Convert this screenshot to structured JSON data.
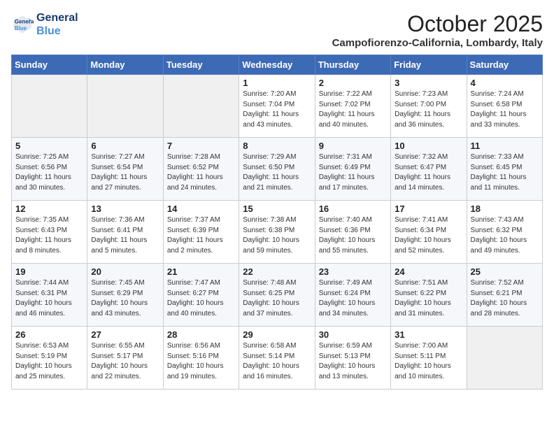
{
  "header": {
    "logo_line1": "General",
    "logo_line2": "Blue",
    "month": "October 2025",
    "location": "Campofiorenzo-California, Lombardy, Italy"
  },
  "days_of_week": [
    "Sunday",
    "Monday",
    "Tuesday",
    "Wednesday",
    "Thursday",
    "Friday",
    "Saturday"
  ],
  "weeks": [
    [
      {
        "day": "",
        "text": ""
      },
      {
        "day": "",
        "text": ""
      },
      {
        "day": "",
        "text": ""
      },
      {
        "day": "1",
        "text": "Sunrise: 7:20 AM\nSunset: 7:04 PM\nDaylight: 11 hours and 43 minutes."
      },
      {
        "day": "2",
        "text": "Sunrise: 7:22 AM\nSunset: 7:02 PM\nDaylight: 11 hours and 40 minutes."
      },
      {
        "day": "3",
        "text": "Sunrise: 7:23 AM\nSunset: 7:00 PM\nDaylight: 11 hours and 36 minutes."
      },
      {
        "day": "4",
        "text": "Sunrise: 7:24 AM\nSunset: 6:58 PM\nDaylight: 11 hours and 33 minutes."
      }
    ],
    [
      {
        "day": "5",
        "text": "Sunrise: 7:25 AM\nSunset: 6:56 PM\nDaylight: 11 hours and 30 minutes."
      },
      {
        "day": "6",
        "text": "Sunrise: 7:27 AM\nSunset: 6:54 PM\nDaylight: 11 hours and 27 minutes."
      },
      {
        "day": "7",
        "text": "Sunrise: 7:28 AM\nSunset: 6:52 PM\nDaylight: 11 hours and 24 minutes."
      },
      {
        "day": "8",
        "text": "Sunrise: 7:29 AM\nSunset: 6:50 PM\nDaylight: 11 hours and 21 minutes."
      },
      {
        "day": "9",
        "text": "Sunrise: 7:31 AM\nSunset: 6:49 PM\nDaylight: 11 hours and 17 minutes."
      },
      {
        "day": "10",
        "text": "Sunrise: 7:32 AM\nSunset: 6:47 PM\nDaylight: 11 hours and 14 minutes."
      },
      {
        "day": "11",
        "text": "Sunrise: 7:33 AM\nSunset: 6:45 PM\nDaylight: 11 hours and 11 minutes."
      }
    ],
    [
      {
        "day": "12",
        "text": "Sunrise: 7:35 AM\nSunset: 6:43 PM\nDaylight: 11 hours and 8 minutes."
      },
      {
        "day": "13",
        "text": "Sunrise: 7:36 AM\nSunset: 6:41 PM\nDaylight: 11 hours and 5 minutes."
      },
      {
        "day": "14",
        "text": "Sunrise: 7:37 AM\nSunset: 6:39 PM\nDaylight: 11 hours and 2 minutes."
      },
      {
        "day": "15",
        "text": "Sunrise: 7:38 AM\nSunset: 6:38 PM\nDaylight: 10 hours and 59 minutes."
      },
      {
        "day": "16",
        "text": "Sunrise: 7:40 AM\nSunset: 6:36 PM\nDaylight: 10 hours and 55 minutes."
      },
      {
        "day": "17",
        "text": "Sunrise: 7:41 AM\nSunset: 6:34 PM\nDaylight: 10 hours and 52 minutes."
      },
      {
        "day": "18",
        "text": "Sunrise: 7:43 AM\nSunset: 6:32 PM\nDaylight: 10 hours and 49 minutes."
      }
    ],
    [
      {
        "day": "19",
        "text": "Sunrise: 7:44 AM\nSunset: 6:31 PM\nDaylight: 10 hours and 46 minutes."
      },
      {
        "day": "20",
        "text": "Sunrise: 7:45 AM\nSunset: 6:29 PM\nDaylight: 10 hours and 43 minutes."
      },
      {
        "day": "21",
        "text": "Sunrise: 7:47 AM\nSunset: 6:27 PM\nDaylight: 10 hours and 40 minutes."
      },
      {
        "day": "22",
        "text": "Sunrise: 7:48 AM\nSunset: 6:25 PM\nDaylight: 10 hours and 37 minutes."
      },
      {
        "day": "23",
        "text": "Sunrise: 7:49 AM\nSunset: 6:24 PM\nDaylight: 10 hours and 34 minutes."
      },
      {
        "day": "24",
        "text": "Sunrise: 7:51 AM\nSunset: 6:22 PM\nDaylight: 10 hours and 31 minutes."
      },
      {
        "day": "25",
        "text": "Sunrise: 7:52 AM\nSunset: 6:21 PM\nDaylight: 10 hours and 28 minutes."
      }
    ],
    [
      {
        "day": "26",
        "text": "Sunrise: 6:53 AM\nSunset: 5:19 PM\nDaylight: 10 hours and 25 minutes."
      },
      {
        "day": "27",
        "text": "Sunrise: 6:55 AM\nSunset: 5:17 PM\nDaylight: 10 hours and 22 minutes."
      },
      {
        "day": "28",
        "text": "Sunrise: 6:56 AM\nSunset: 5:16 PM\nDaylight: 10 hours and 19 minutes."
      },
      {
        "day": "29",
        "text": "Sunrise: 6:58 AM\nSunset: 5:14 PM\nDaylight: 10 hours and 16 minutes."
      },
      {
        "day": "30",
        "text": "Sunrise: 6:59 AM\nSunset: 5:13 PM\nDaylight: 10 hours and 13 minutes."
      },
      {
        "day": "31",
        "text": "Sunrise: 7:00 AM\nSunset: 5:11 PM\nDaylight: 10 hours and 10 minutes."
      },
      {
        "day": "",
        "text": ""
      }
    ]
  ]
}
